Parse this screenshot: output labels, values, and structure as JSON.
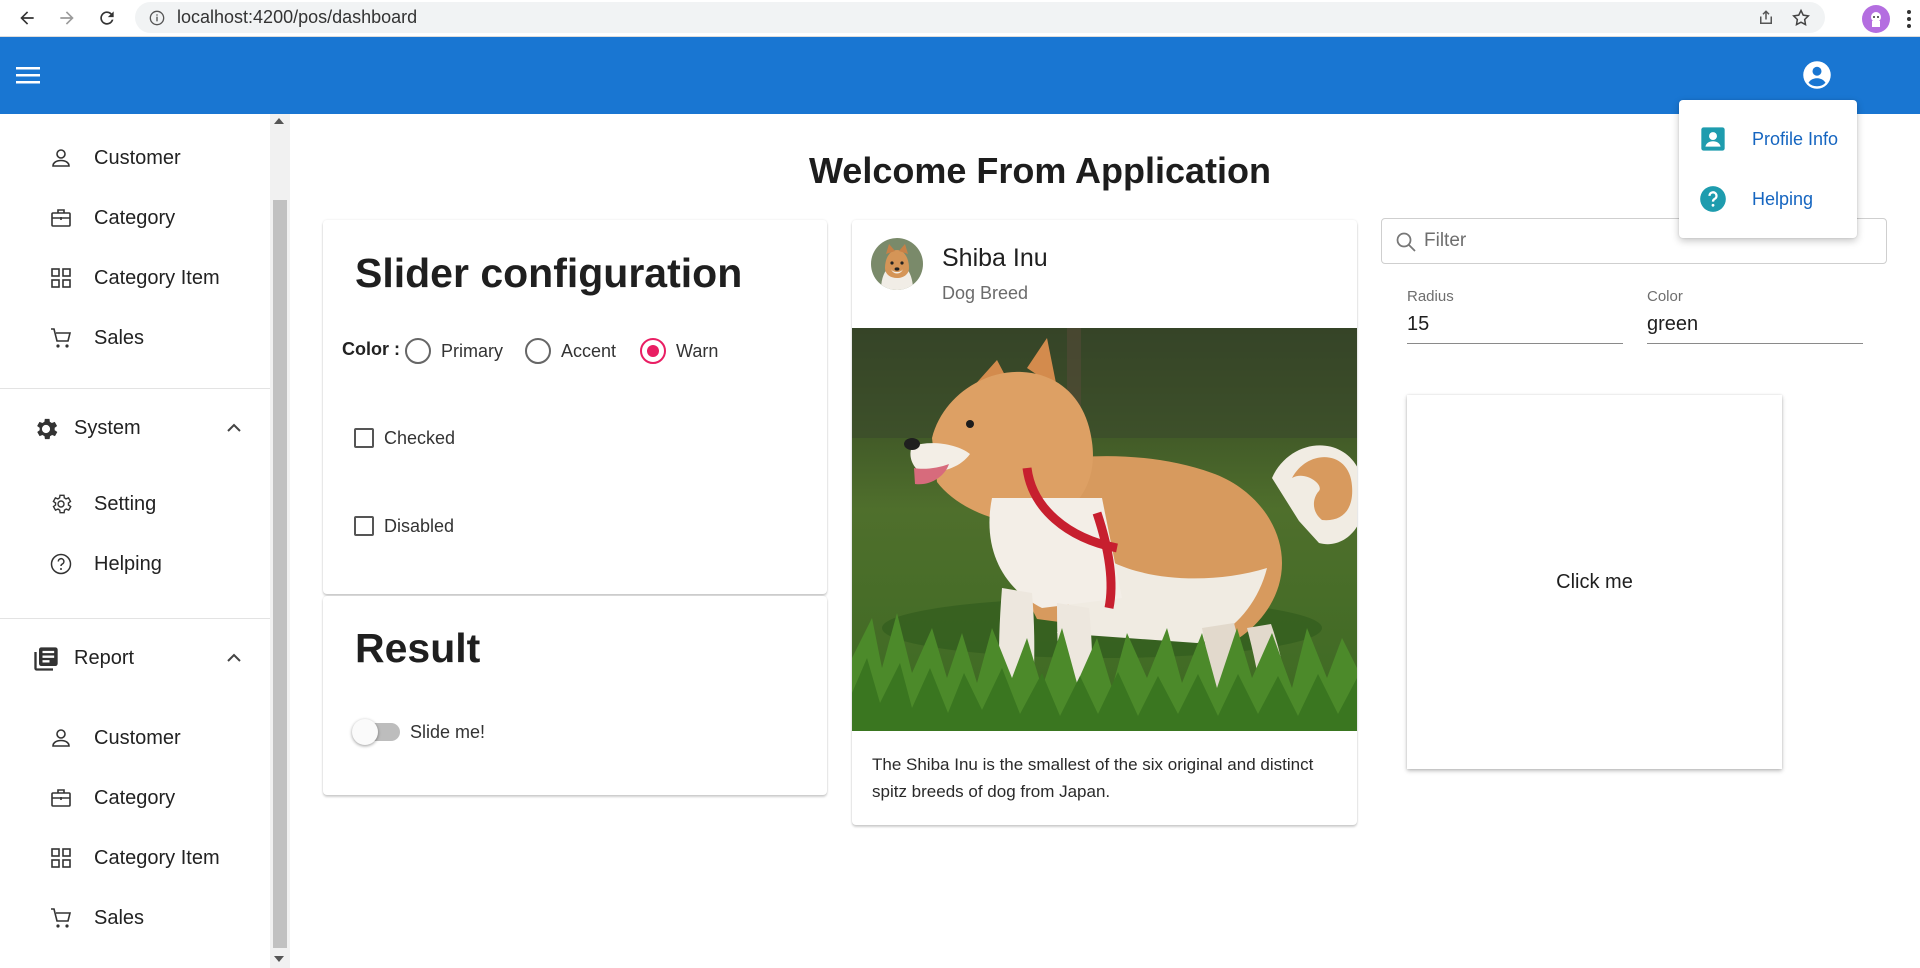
{
  "browser": {
    "url": "localhost:4200/pos/dashboard"
  },
  "sidebar": {
    "items_top": [
      {
        "label": "Customer",
        "icon": "person-icon"
      },
      {
        "label": "Category",
        "icon": "briefcase-icon"
      },
      {
        "label": "Category Item",
        "icon": "grid-icon"
      },
      {
        "label": "Sales",
        "icon": "cart-icon"
      }
    ],
    "system": {
      "label": "System",
      "expanded": true,
      "items": [
        {
          "label": "Setting",
          "icon": "gear-icon"
        },
        {
          "label": "Helping",
          "icon": "help-icon"
        }
      ]
    },
    "report": {
      "label": "Report",
      "expanded": true,
      "items": [
        {
          "label": "Customer",
          "icon": "person-icon"
        },
        {
          "label": "Category",
          "icon": "briefcase-icon"
        },
        {
          "label": "Category Item",
          "icon": "grid-icon"
        },
        {
          "label": "Sales",
          "icon": "cart-icon"
        }
      ]
    }
  },
  "main": {
    "title": "Welcome From Application"
  },
  "slider_card": {
    "heading": "Slider configuration",
    "color_label": "Color :",
    "radios": [
      {
        "label": "Primary",
        "checked": false
      },
      {
        "label": "Accent",
        "checked": false
      },
      {
        "label": "Warn",
        "checked": true
      }
    ],
    "checkbox_checked": {
      "label": "Checked",
      "checked": false
    },
    "checkbox_disabled": {
      "label": "Disabled",
      "checked": false
    },
    "result_heading": "Result",
    "toggle": {
      "label": "Slide me!",
      "on": false
    }
  },
  "dog_card": {
    "title": "Shiba Inu",
    "subtitle": "Dog Breed",
    "description": "The Shiba Inu is the smallest of the six original and distinct spitz breeds of dog from Japan."
  },
  "right_panel": {
    "filter_placeholder": "Filter",
    "radius": {
      "label": "Radius",
      "value": "15"
    },
    "color": {
      "label": "Color",
      "value": "green"
    },
    "click_label": "Click me"
  },
  "account_menu": {
    "items": [
      {
        "label": "Profile Info",
        "icon": "contact-card-icon"
      },
      {
        "label": "Helping",
        "icon": "help-circle-icon"
      }
    ]
  },
  "colors": {
    "toolbar": "#1976d2",
    "warn": "#e91e63",
    "menu_icon": "#1e9cae",
    "menu_text": "#1565c0"
  }
}
